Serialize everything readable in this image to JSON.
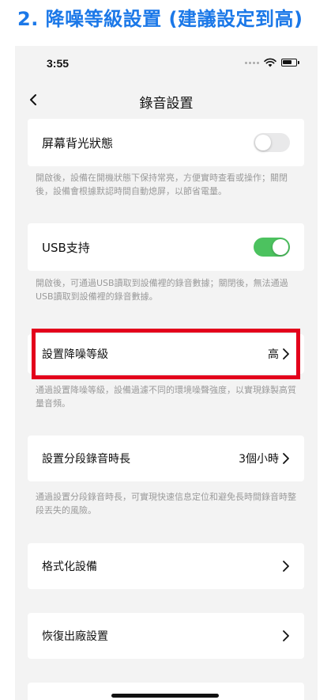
{
  "banner": {
    "title": "2. 降噪等級設置 (建議設定到高)"
  },
  "status_bar": {
    "time": "3:55"
  },
  "nav": {
    "title": "錄音設置"
  },
  "settings": {
    "screen_on": {
      "label": "屏幕背光狀態",
      "enabled": false,
      "note": "開啟後，設備在開機狀態下保持常亮，方便實時查看或操作；關閉後，設備會根據默認時間自動熄屏，以節省電量。"
    },
    "usb": {
      "label": "USB支持",
      "enabled": true,
      "note": "開啟後，可通過USB讀取到設備裡的錄音數據；關閉後，無法通過USB讀取到設備裡的錄音數據。"
    },
    "noise_reduction": {
      "label": "設置降噪等級",
      "value": "高",
      "note": "通過設置降噪等級，設備過濾不同的環境噪聲強度，以實現錄製高質量音頻。"
    },
    "segment": {
      "label": "設置分段錄音時長",
      "value": "3個小時",
      "note": "通過設置分段錄音時長，可實現快速信息定位和避免長時間錄音時整段丟失的風險。"
    },
    "format": {
      "label": "格式化設備"
    },
    "factory_reset": {
      "label": "恢復出廠設置"
    }
  },
  "colors": {
    "accent_blue": "#1b78e8",
    "toggle_on": "#4cc25f",
    "highlight_red": "#e3001b"
  }
}
